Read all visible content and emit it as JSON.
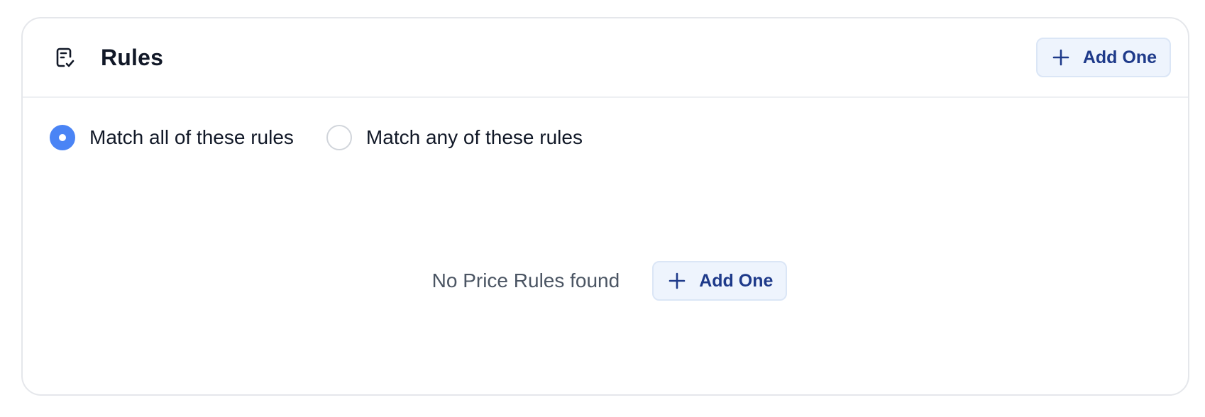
{
  "header": {
    "icon": "clipboard-check-icon",
    "title": "Rules",
    "add_button_label": "Add One"
  },
  "match_options": [
    {
      "label": "Match all of these rules",
      "selected": true
    },
    {
      "label": "Match any of these rules",
      "selected": false
    }
  ],
  "empty_state": {
    "message": "No Price Rules found",
    "add_button_label": "Add One"
  },
  "colors": {
    "accent": "#4a84f5",
    "button_bg": "#eef4fd",
    "button_text": "#1e3a8a",
    "border": "#e5e7eb"
  }
}
